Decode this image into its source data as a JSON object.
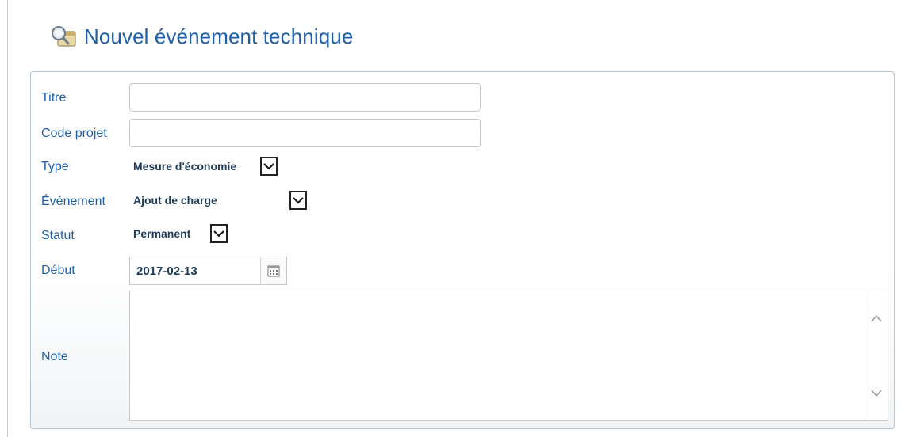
{
  "header": {
    "title": "Nouvel événement technique"
  },
  "form": {
    "titre": {
      "label": "Titre",
      "value": ""
    },
    "code_projet": {
      "label": "Code projet",
      "value": ""
    },
    "type": {
      "label": "Type",
      "selected": "Mesure d'économie"
    },
    "evenement": {
      "label": "Événement",
      "selected": "Ajout de charge"
    },
    "statut": {
      "label": "Statut",
      "selected": "Permanent"
    },
    "debut": {
      "label": "Début",
      "value": "2017-02-13"
    },
    "note": {
      "label": "Note",
      "value": ""
    }
  },
  "colors": {
    "accent": "#1f5fa8",
    "value_text": "#1c3a57",
    "border": "#c8c8c8"
  },
  "icons": {
    "header": "search-calendar-icon",
    "dropdown": "chevron-down-icon",
    "date_picker": "calendar-icon",
    "scroll_up": "chevron-up-icon",
    "scroll_down": "chevron-down-icon"
  }
}
